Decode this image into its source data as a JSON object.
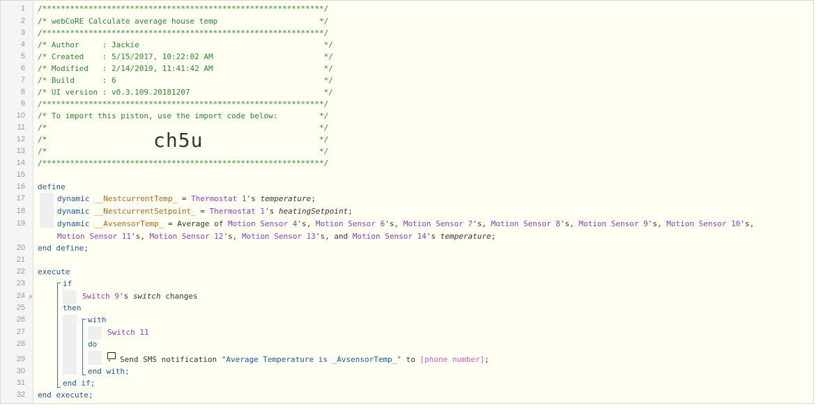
{
  "lines": [
    {
      "n": "1",
      "t": "/*************************************************************/"
    },
    {
      "n": "2",
      "t": "/* webCoRE Calculate average house temp                      */"
    },
    {
      "n": "3",
      "t": "/*************************************************************/"
    },
    {
      "n": "4",
      "t": "/* Author     : Jackie                                        */"
    },
    {
      "n": "5",
      "t": "/* Created    : 5/15/2017, 10:22:02 AM                        */"
    },
    {
      "n": "6",
      "t": "/* Modified   : 2/14/2019, 11:41:42 AM                        */"
    },
    {
      "n": "7",
      "t": "/* Build      : 6                                             */"
    },
    {
      "n": "8",
      "t": "/* UI version : v0.3.109.20181207                             */"
    },
    {
      "n": "9",
      "t": "/*************************************************************/"
    },
    {
      "n": "10",
      "t": "/* To import this piston, use the import code below:         */"
    },
    {
      "n": "11",
      "t": "/*                                                           */"
    },
    {
      "n": "12",
      "t": "/*                                                           */"
    },
    {
      "n": "13",
      "t": "/*                                                           */"
    },
    {
      "n": "14",
      "t": "/*************************************************************/"
    },
    {
      "n": "15",
      "t": ""
    },
    {
      "n": "16"
    },
    {
      "n": "17"
    },
    {
      "n": "18"
    },
    {
      "n": "19"
    },
    {
      "n": ""
    },
    {
      "n": "20"
    },
    {
      "n": "21"
    },
    {
      "n": "22"
    },
    {
      "n": "23"
    },
    {
      "n": "24"
    },
    {
      "n": "25"
    },
    {
      "n": "26"
    },
    {
      "n": "27"
    },
    {
      "n": "28"
    },
    {
      "n": "29"
    },
    {
      "n": "30"
    },
    {
      "n": "31"
    },
    {
      "n": "32"
    }
  ],
  "import_code": "ch5u",
  "code": {
    "define": "define",
    "dynamic": "dynamic",
    "v1": "__NestcurrentTemp_",
    "eq": " = ",
    "thermostat": "Thermostat 1",
    "apos_s": "'s ",
    "temperature": "temperature",
    "semi": ";",
    "v2": "__NestcurrentSetpoint_",
    "heating": "heatingSetpoint",
    "v3": "__AvsensorTemp_",
    "avg_of": " = Average of ",
    "ms4": "Motion Sensor 4",
    "ms6": "Motion Sensor 6",
    "ms7": "Motion Sensor 7",
    "ms8": "Motion Sensor 8",
    "ms9": "Motion Sensor 9",
    "ms10": "Motion Sensor 10",
    "ms11": "Motion Sensor 11",
    "ms12": "Motion Sensor 12",
    "ms13": "Motion Sensor 13",
    "ms14": "Motion Sensor 14",
    "sep": "'s, ",
    "and": "'s, and ",
    "end_define": "end define;",
    "execute": "execute",
    "if": "if",
    "switch9": "Switch 9",
    "switch_attr": "switch",
    "changes": " changes",
    "then": "then",
    "with": "with",
    "switch11": "Switch 11",
    "do": "do",
    "send_sms": "Send SMS notification ",
    "message": "\"Average Temperature is _AvsensorTemp_\"",
    "to": " to ",
    "phone": "[phone number]",
    "end_with": "end with;",
    "end_if": "end if;",
    "end_execute": "end execute;"
  },
  "colors": {
    "comment": "#2b8a2b",
    "keyword": "#1a57a8",
    "variable": "#b5651d",
    "device": "#8d3fc2",
    "bolt": "#f07e1e"
  },
  "icons": [
    "lightning-bolt-icon",
    "speech-bubble-icon"
  ]
}
